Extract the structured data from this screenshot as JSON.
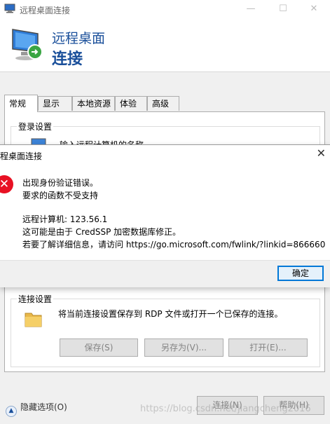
{
  "window": {
    "title": "远程桌面连接",
    "min_glyph": "—",
    "max_glyph": "☐",
    "close_glyph": "✕"
  },
  "header": {
    "line1": "远程桌面",
    "line2": "连接"
  },
  "tabs": [
    {
      "label": "常规",
      "active": true
    },
    {
      "label": "显示"
    },
    {
      "label": "本地资源"
    },
    {
      "label": "体验"
    },
    {
      "label": "高级"
    }
  ],
  "general": {
    "login_group_label": "登录设置",
    "login_hint": "输入远程计算机的名称",
    "conn_group_label": "连接设置",
    "conn_desc": "将当前连接设置保存到 RDP 文件或打开一个已保存的连接。",
    "save_label": "保存(S)",
    "save_as_label": "另存为(V)...",
    "open_label": "打开(E)..."
  },
  "bottom": {
    "hide_options": "隐藏选项(O)",
    "connect_label": "连接(N)",
    "help_label": "帮助(H)"
  },
  "dialog": {
    "title": "程桌面连接",
    "close_glyph": "✕",
    "error_glyph": "✕",
    "line1": "出现身份验证错误。",
    "line2": "要求的函数不受支持",
    "line3": "远程计算机: 123.56.1",
    "line4": "这可能是由于 CredSSP 加密数据库修正。",
    "line5": "若要了解详细信息，请访问 https://go.microsoft.com/fwlink/?linkid=866660",
    "ok_label": "确定"
  },
  "watermark": "https://blog.csdn.net/jiangcheng2016"
}
